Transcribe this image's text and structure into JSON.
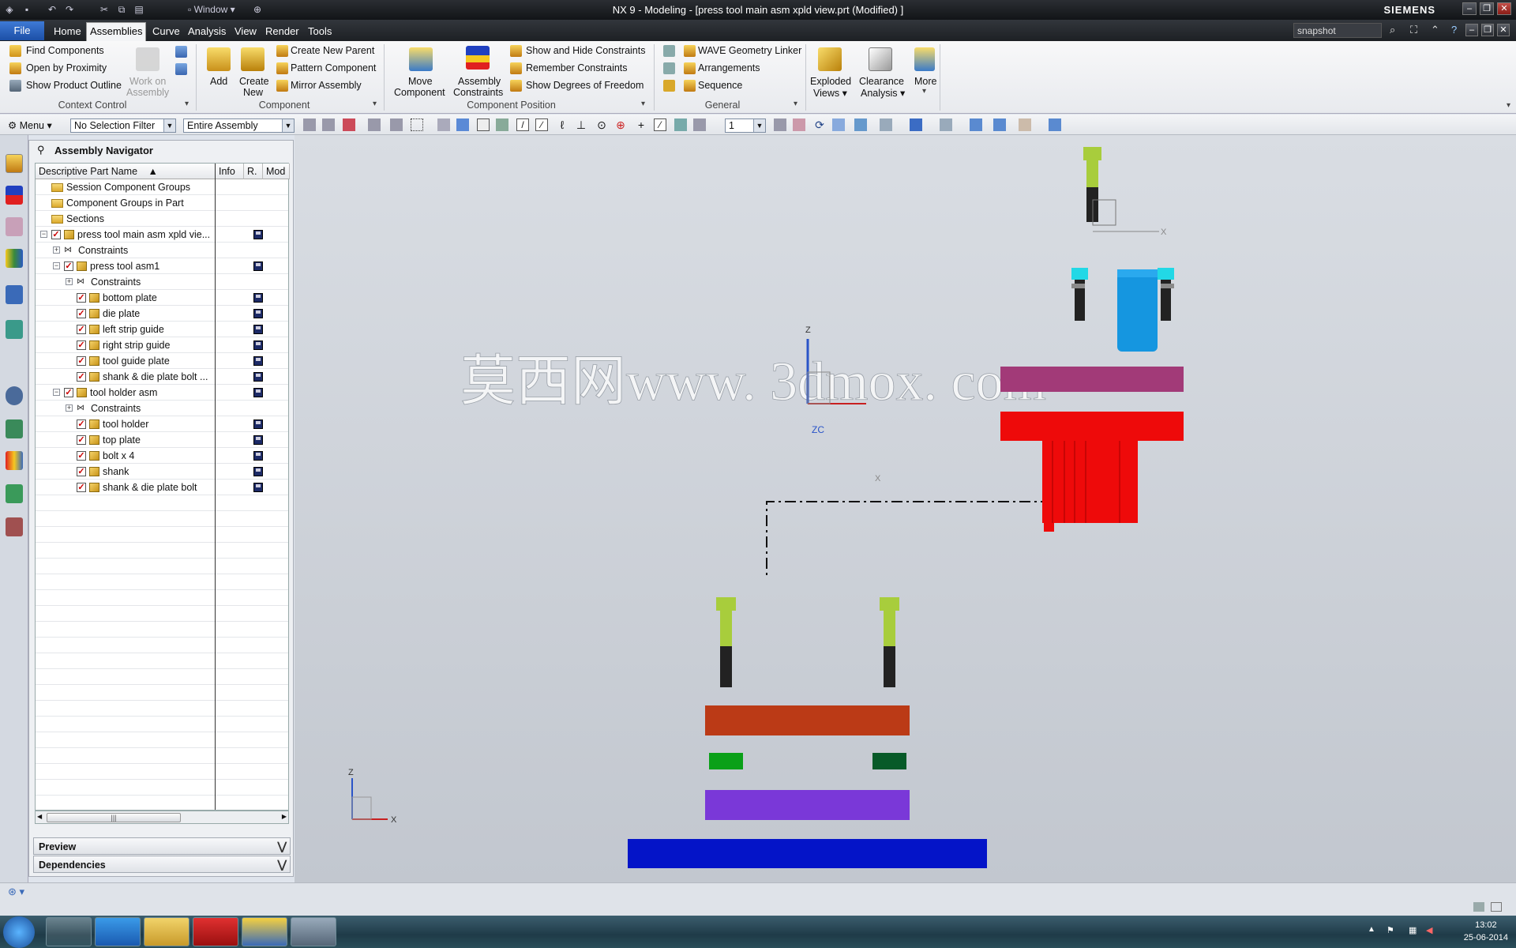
{
  "window": {
    "title": "NX 9 - Modeling - [press tool main asm xpld view.prt (Modified) ]",
    "brand": "SIEMENS",
    "window_menu_label": "Window",
    "controls": [
      "minimize-icon",
      "restore-icon",
      "close-icon"
    ]
  },
  "menubar": {
    "tabs": [
      "File",
      "Home",
      "Assemblies",
      "Curve",
      "Analysis",
      "View",
      "Render",
      "Tools"
    ],
    "active_tab": "Assemblies",
    "search_value": "snapshot"
  },
  "ribbon": {
    "context_control": {
      "group_label": "Context Control",
      "items": [
        "Find Components",
        "Open by Proximity",
        "Show Product Outline"
      ],
      "work_on_assembly": [
        "Work on",
        "Assembly"
      ]
    },
    "component": {
      "group_label": "Component",
      "add": "Add",
      "create_new": [
        "Create",
        "New"
      ],
      "items": [
        "Create New Parent",
        "Pattern Component",
        "Mirror Assembly"
      ]
    },
    "component_position": {
      "group_label": "Component Position",
      "move": [
        "Move",
        "Component"
      ],
      "constraints": [
        "Assembly",
        "Constraints"
      ],
      "items": [
        "Show and Hide Constraints",
        "Remember Constraints",
        "Show Degrees of Freedom"
      ]
    },
    "general": {
      "group_label": "General",
      "items": [
        "WAVE Geometry Linker",
        "Arrangements",
        "Sequence"
      ]
    },
    "exploded": [
      "Exploded",
      "Views ▾"
    ],
    "clearance": [
      "Clearance",
      "Analysis ▾"
    ],
    "more": "More"
  },
  "toolbar": {
    "menu_label": "Menu ▾",
    "selection_filter": "No Selection Filter",
    "scope": "Entire Assembly",
    "layer_value": "1"
  },
  "navigator": {
    "title": "Assembly Navigator",
    "columns": [
      "Descriptive Part Name",
      "Info",
      "R.",
      "Mod"
    ],
    "rows": [
      {
        "label": "Session Component Groups",
        "kind": "folder",
        "depth": 0
      },
      {
        "label": "Component Groups in Part",
        "kind": "folder",
        "depth": 0
      },
      {
        "label": "Sections",
        "kind": "folder",
        "depth": 0
      },
      {
        "label": "press tool main asm xpld vie...",
        "kind": "assembly",
        "depth": 0,
        "expander": "⊟",
        "saved": true
      },
      {
        "label": "Constraints",
        "kind": "constraints",
        "depth": 1,
        "expander": "⊞"
      },
      {
        "label": "press tool asm1",
        "kind": "assembly",
        "depth": 1,
        "expander": "⊟",
        "saved": true
      },
      {
        "label": "Constraints",
        "kind": "constraints",
        "depth": 2,
        "expander": "⊞"
      },
      {
        "label": "bottom plate",
        "kind": "part",
        "depth": 2,
        "saved": true
      },
      {
        "label": "die plate",
        "kind": "part",
        "depth": 2,
        "saved": true
      },
      {
        "label": "left strip guide",
        "kind": "part",
        "depth": 2,
        "saved": true
      },
      {
        "label": "right strip guide",
        "kind": "part",
        "depth": 2,
        "saved": true
      },
      {
        "label": "tool guide plate",
        "kind": "part",
        "depth": 2,
        "saved": true
      },
      {
        "label": "shank & die plate bolt ...",
        "kind": "part",
        "depth": 2,
        "saved": true
      },
      {
        "label": "tool holder asm",
        "kind": "assembly",
        "depth": 1,
        "expander": "⊟",
        "saved": true
      },
      {
        "label": "Constraints",
        "kind": "constraints",
        "depth": 2,
        "expander": "⊞"
      },
      {
        "label": "tool holder",
        "kind": "part",
        "depth": 2,
        "saved": true
      },
      {
        "label": "top plate",
        "kind": "part",
        "depth": 2,
        "saved": true
      },
      {
        "label": "bolt x 4",
        "kind": "part",
        "depth": 2,
        "saved": true
      },
      {
        "label": "shank",
        "kind": "part",
        "depth": 2,
        "saved": true
      },
      {
        "label": "shank & die plate bolt",
        "kind": "part",
        "depth": 2,
        "saved": true
      }
    ],
    "sections": [
      "Preview",
      "Dependencies"
    ]
  },
  "viewport": {
    "watermark": "莫西网www. 3dmox. com",
    "axis_labels": {
      "z": "Z",
      "zc": "ZC",
      "x": "X",
      "xc": "X"
    },
    "colors": {
      "bottom_plate": "#0414c8",
      "tool_guide_plate": "#7a38d8",
      "left_strip_guide": "#0aa018",
      "right_strip_guide": "#075a28",
      "die_plate": "#bb3a16",
      "bolt_head": "#a8cd3c",
      "top_plate": "#a23a78",
      "tool_holder": "#ee0a0a",
      "shank": "#1596e0",
      "bolt_cap": "#22d8e6"
    }
  },
  "taskbar": {
    "time": "13:02",
    "date": "25-06-2014"
  }
}
